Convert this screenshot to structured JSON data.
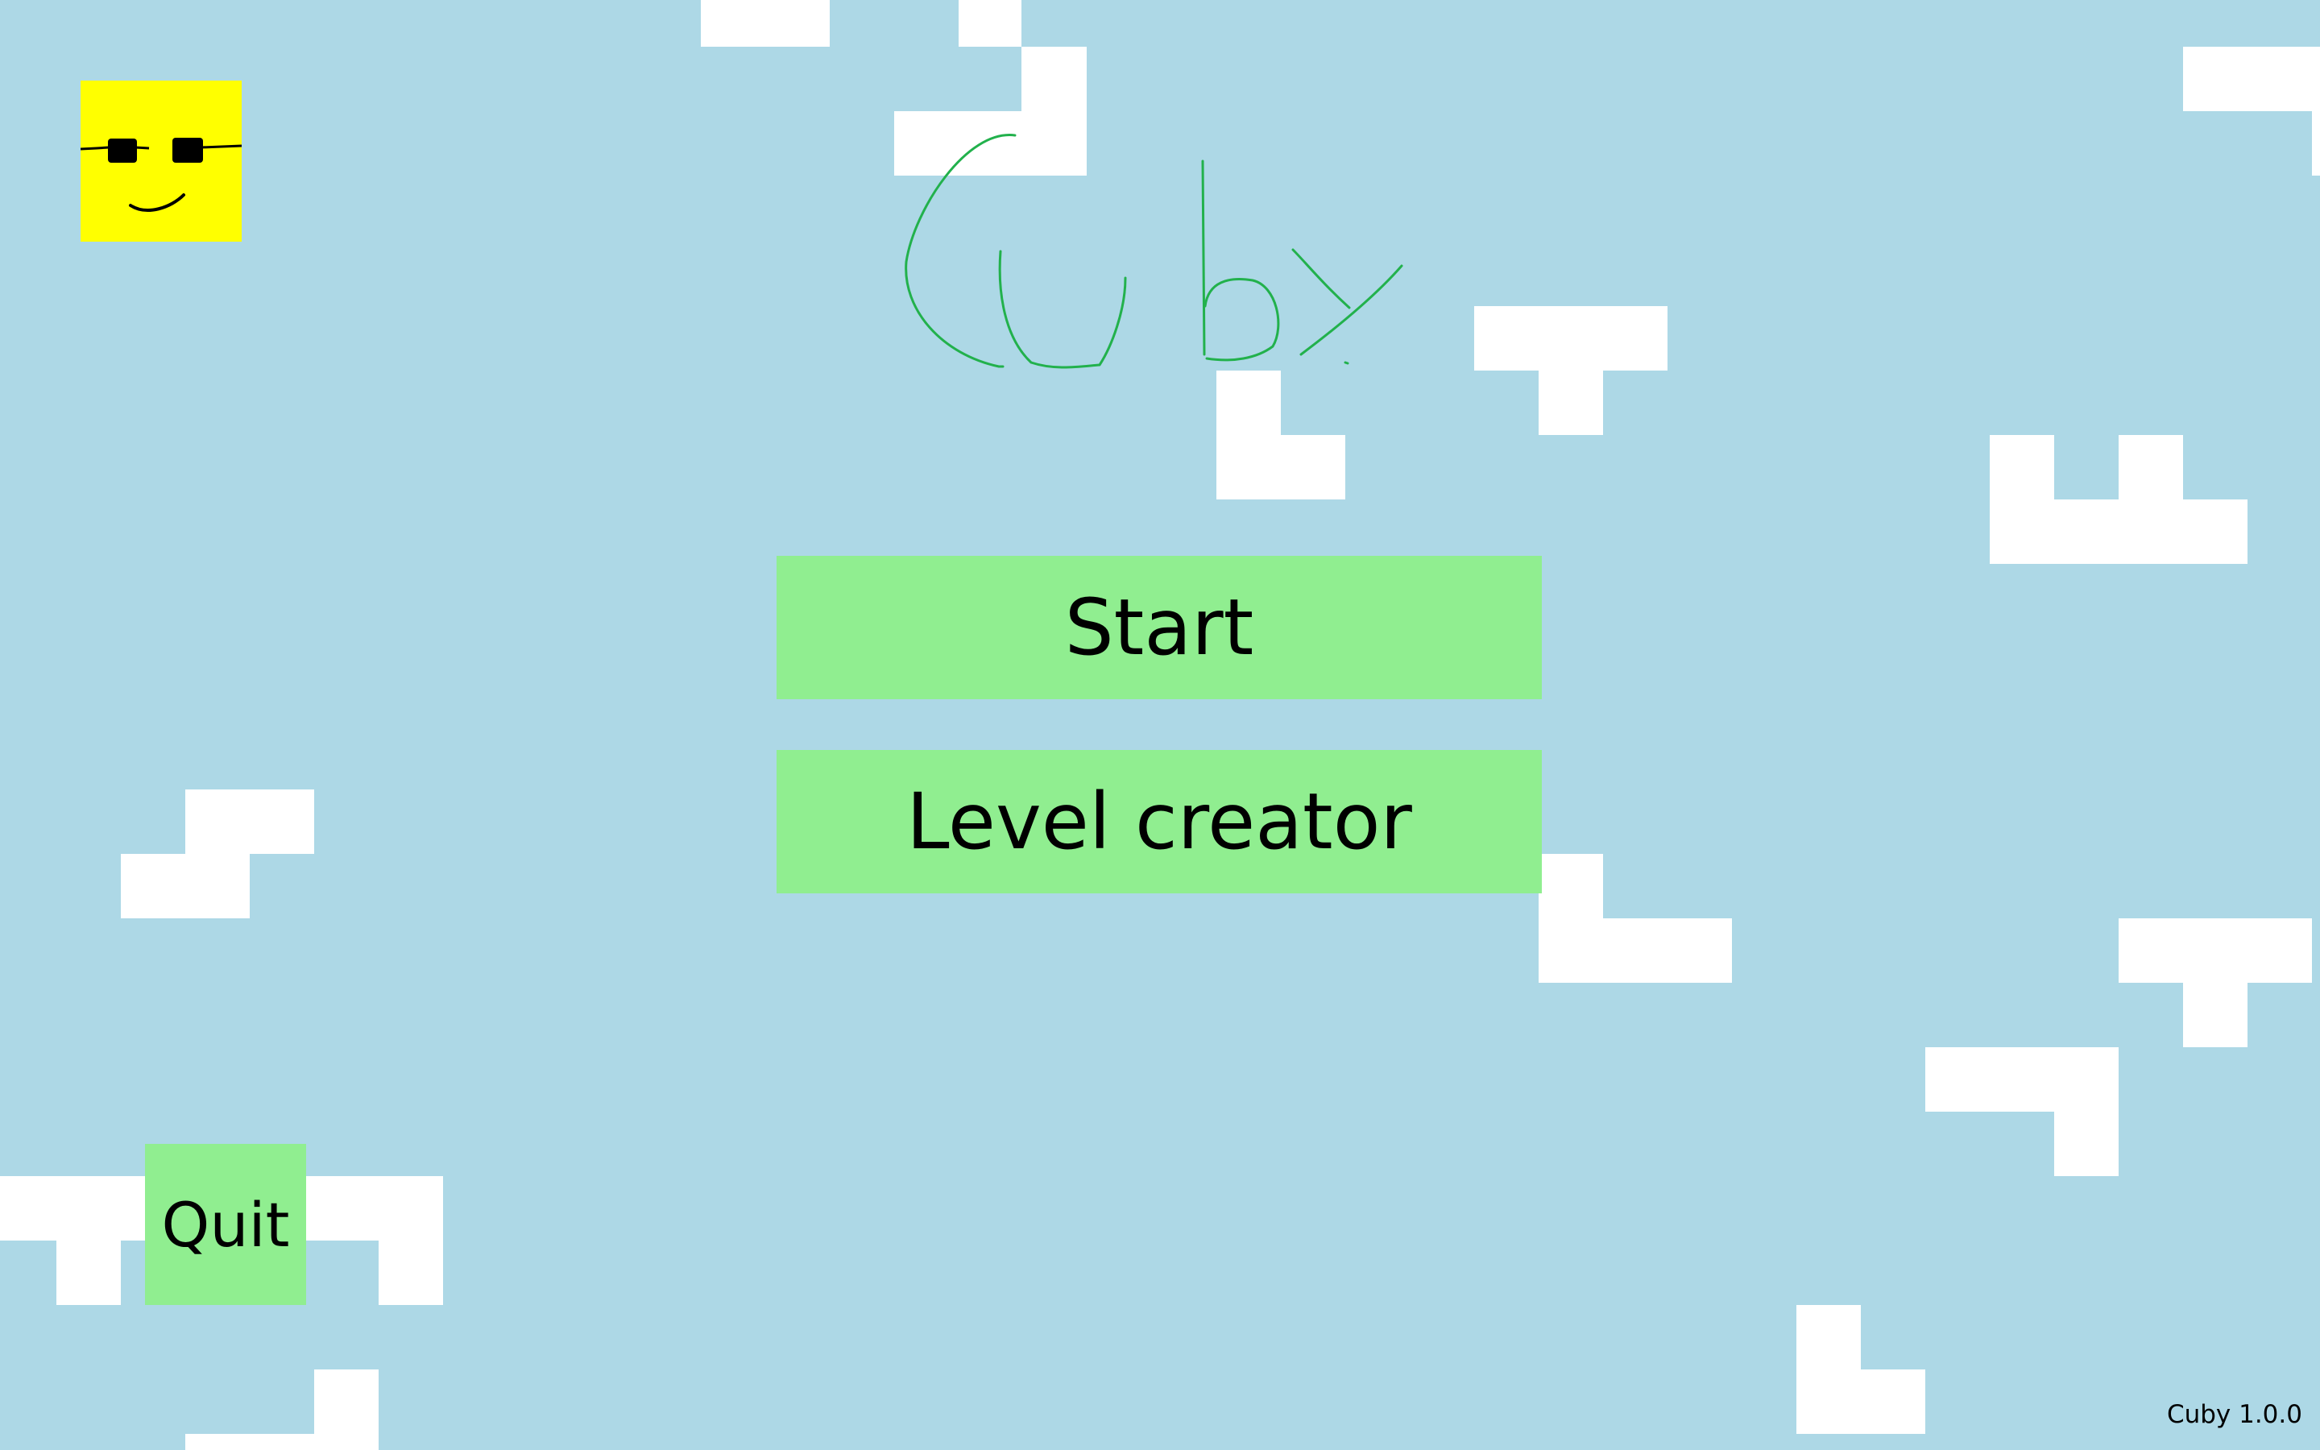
{
  "game": {
    "title": "Cuby",
    "version": "Cuby 1.0.0",
    "colors": {
      "background": "#add8e6",
      "button": "#90ee90",
      "block": "#ffffff",
      "logo_stroke": "#22b14c",
      "avatar": "#ffff00"
    }
  },
  "avatar": {
    "icon": "sunglasses-cube-face-icon"
  },
  "menu": {
    "start_label": "Start",
    "level_creator_label": "Level creator",
    "quit_label": "Quit"
  }
}
